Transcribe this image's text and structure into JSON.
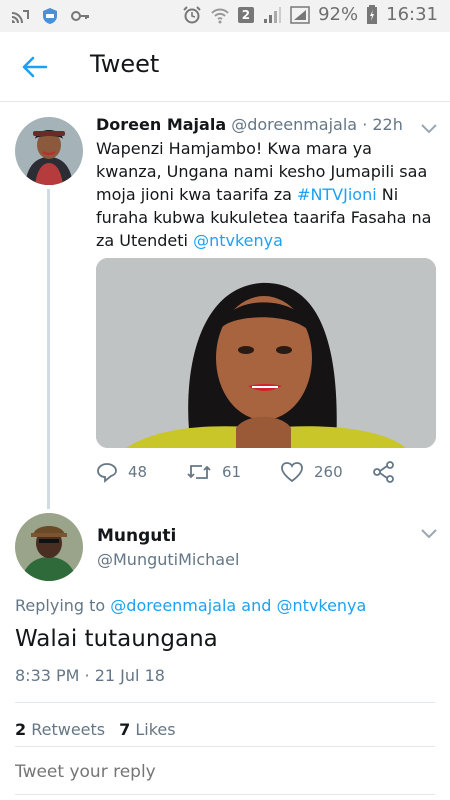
{
  "status_bar": {
    "battery": "92%",
    "time": "16:31",
    "sim": "2"
  },
  "header": {
    "title": "Tweet"
  },
  "parent_tweet": {
    "name": "Doreen Majala",
    "handle": "@doreenmajala",
    "age": "· 22h",
    "text_part1": "Wapenzi Hamjambo! Kwa mara ya kwanza, Ungana nami kesho Jumapili saa moja jioni kwa taarifa za ",
    "hashtag": "#NTVJioni",
    "text_part2": "  Ni furaha kubwa kukuletea taarifa Fasaha na za Utendeti ",
    "mention": "@ntvkenya",
    "replies": "48",
    "retweets": "61",
    "likes": "260"
  },
  "reply_tweet": {
    "name": "Munguti",
    "handle": "@MungutiMichael",
    "replying_prefix": "Replying to",
    "replying_user1": "@doreenmajala",
    "replying_and": "and",
    "replying_user2": "@ntvkenya",
    "text": "Walai tutaungana",
    "time": "8:33 PM · 21 Jul 18",
    "retweet_count": "2",
    "retweet_label": "Retweets",
    "like_count": "7",
    "like_label": "Likes"
  },
  "compose": {
    "placeholder": "Tweet your reply"
  },
  "colors": {
    "accent": "#1da1f2",
    "secondary_text": "#657786",
    "divider": "#e1e8ed"
  }
}
